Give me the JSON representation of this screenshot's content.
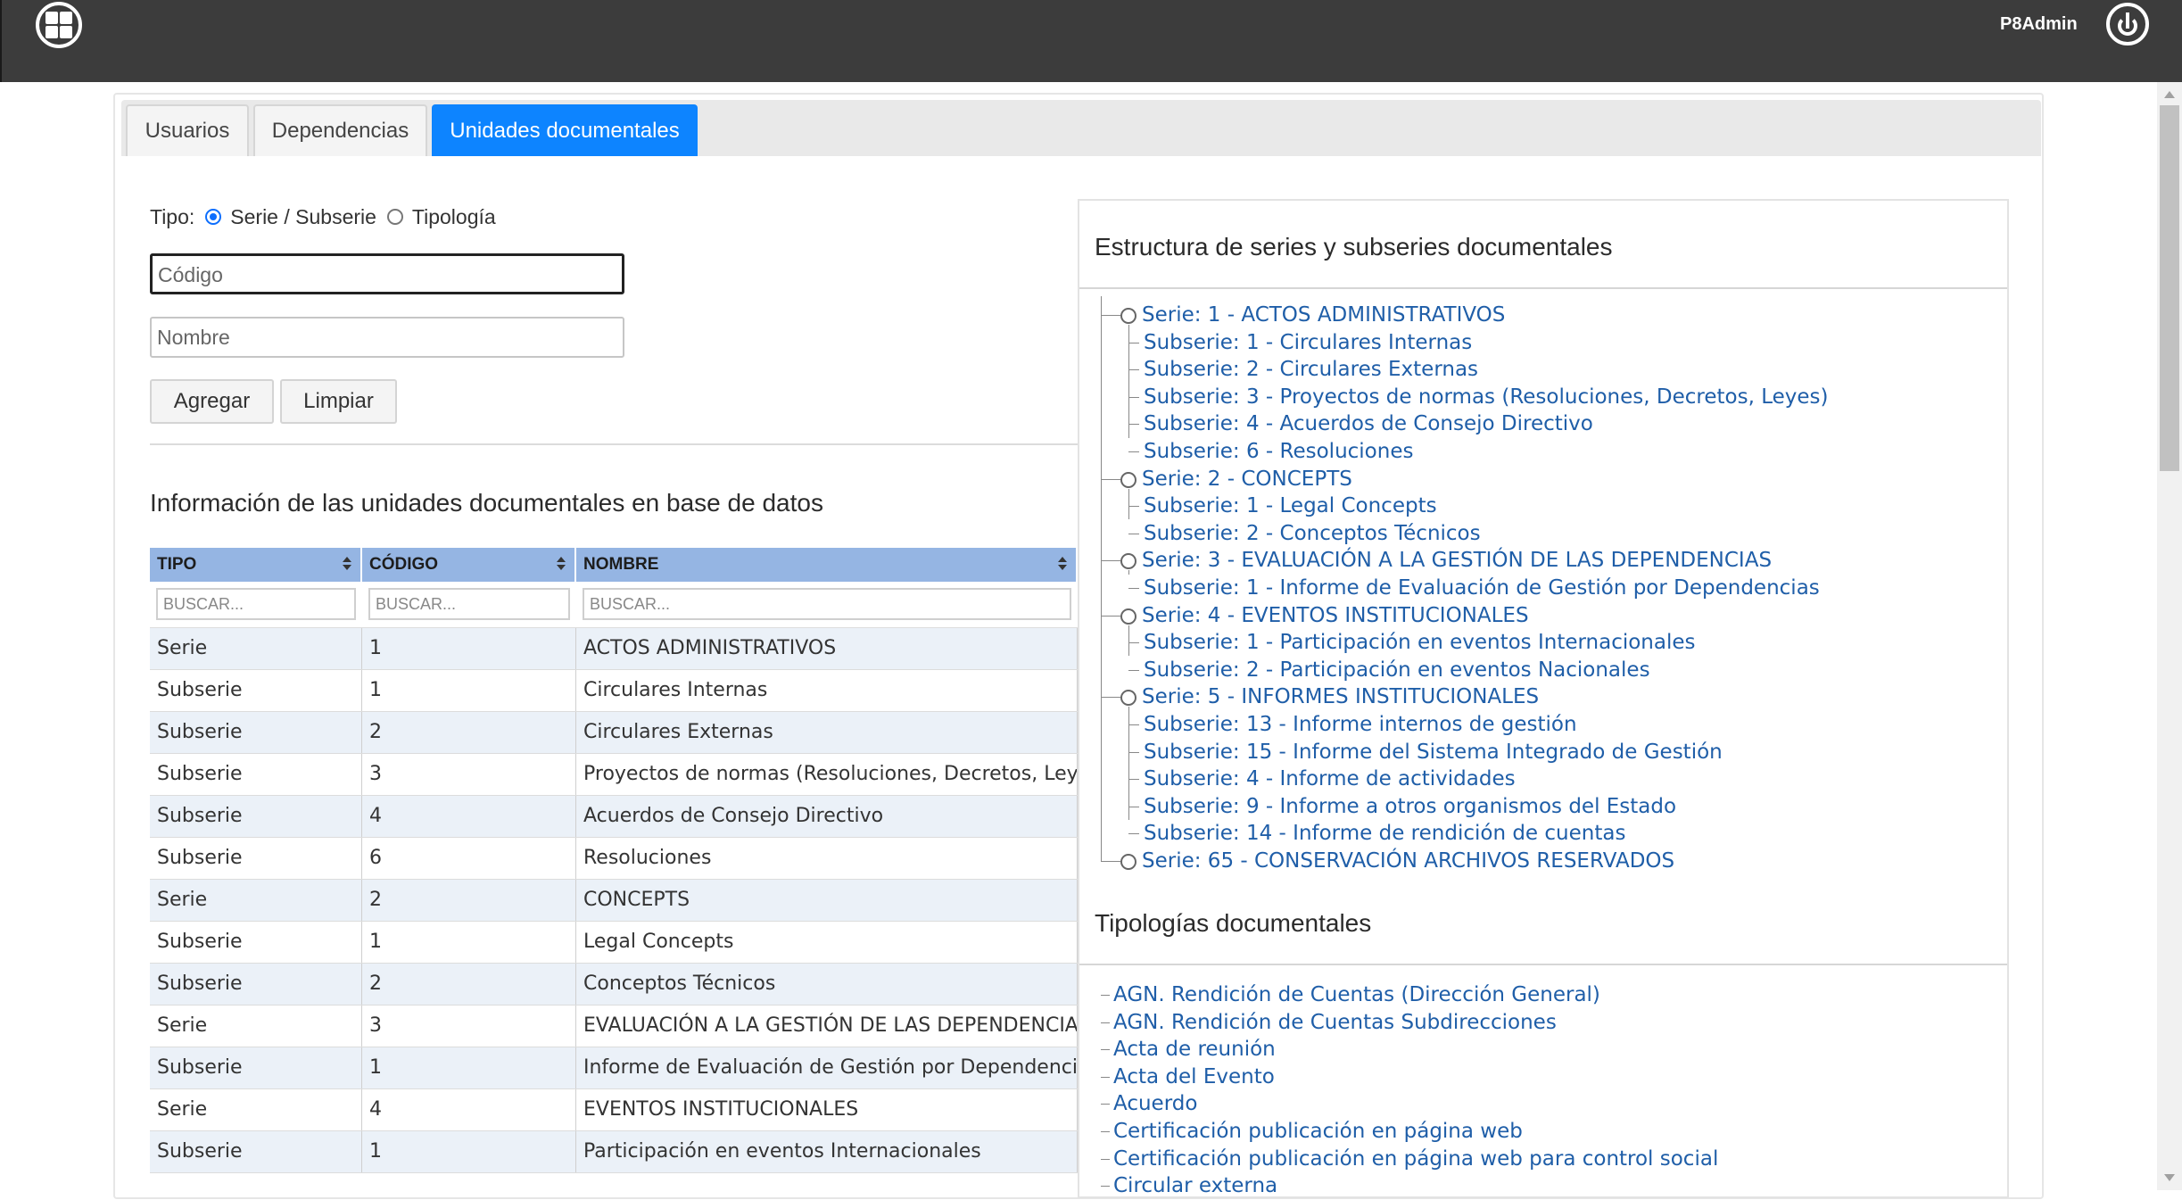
{
  "header": {
    "user": "P8Admin"
  },
  "tabs": [
    "Usuarios",
    "Dependencias",
    "Unidades documentales"
  ],
  "form": {
    "tipo_label": "Tipo:",
    "option_serie": "Serie / Subserie",
    "option_tipologia": "Tipología",
    "selected": "Serie / Subserie",
    "codigo_placeholder": "Código",
    "nombre_placeholder": "Nombre",
    "add_label": "Agregar",
    "clear_label": "Limpiar"
  },
  "table": {
    "title": "Información de las unidades documentales en base de datos",
    "columns": [
      "TIPO",
      "CÓDIGO",
      "NOMBRE"
    ],
    "filter_placeholder": "BUSCAR...",
    "rows": [
      [
        "Serie",
        "1",
        "ACTOS ADMINISTRATIVOS"
      ],
      [
        "Subserie",
        "1",
        "Circulares Internas"
      ],
      [
        "Subserie",
        "2",
        "Circulares Externas"
      ],
      [
        "Subserie",
        "3",
        "Proyectos de normas (Resoluciones, Decretos, Leyes)"
      ],
      [
        "Subserie",
        "4",
        "Acuerdos de Consejo Directivo"
      ],
      [
        "Subserie",
        "6",
        "Resoluciones"
      ],
      [
        "Serie",
        "2",
        "CONCEPTS"
      ],
      [
        "Subserie",
        "1",
        "Legal Concepts"
      ],
      [
        "Subserie",
        "2",
        "Conceptos Técnicos"
      ],
      [
        "Serie",
        "3",
        "EVALUACIÓN A LA GESTIÓN DE LAS DEPENDENCIAS"
      ],
      [
        "Subserie",
        "1",
        "Informe de Evaluación de Gestión por Dependencias"
      ],
      [
        "Serie",
        "4",
        "EVENTOS INSTITUCIONALES"
      ],
      [
        "Subserie",
        "1",
        "Participación en eventos Internacionales"
      ]
    ]
  },
  "tree": {
    "title": "Estructura de series y subseries documentales",
    "series": [
      {
        "label": "Serie: 1 - ACTOS ADMINISTRATIVOS",
        "subseries": [
          "Subserie: 1 - Circulares Internas",
          "Subserie: 2 - Circulares Externas",
          "Subserie: 3 - Proyectos de normas (Resoluciones, Decretos, Leyes)",
          "Subserie: 4 - Acuerdos de Consejo Directivo",
          "Subserie: 6 - Resoluciones"
        ]
      },
      {
        "label": "Serie: 2 - CONCEPTS",
        "subseries": [
          "Subserie: 1 - Legal Concepts",
          "Subserie: 2 - Conceptos Técnicos"
        ]
      },
      {
        "label": "Serie: 3 - EVALUACIÓN A LA GESTIÓN DE LAS DEPENDENCIAS",
        "subseries": [
          "Subserie: 1 - Informe de Evaluación de Gestión por Dependencias"
        ]
      },
      {
        "label": "Serie: 4 - EVENTOS INSTITUCIONALES",
        "subseries": [
          "Subserie: 1 - Participación en eventos Internacionales",
          "Subserie: 2 - Participación en eventos Nacionales"
        ]
      },
      {
        "label": "Serie: 5 - INFORMES INSTITUCIONALES",
        "subseries": [
          "Subserie: 13 - Informe internos de gestión",
          "Subserie: 15 - Informe del Sistema Integrado de Gestión",
          "Subserie: 4 - Informe de actividades",
          "Subserie: 9 - Informe a otros organismos del Estado",
          "Subserie: 14 - Informe de rendición de cuentas"
        ]
      },
      {
        "label": "Serie: 65 - CONSERVACIÓN ARCHIVOS RESERVADOS",
        "subseries": []
      }
    ]
  },
  "tipologias": {
    "title": "Tipologías documentales",
    "items": [
      "AGN. Rendición de Cuentas (Dirección General)",
      "AGN. Rendición de Cuentas Subdirecciones",
      "Acta de reunión",
      "Acta del Evento",
      "Acuerdo",
      "Certificación publicación en página web",
      "Certificación publicación en página web para control social",
      "Circular externa"
    ]
  }
}
